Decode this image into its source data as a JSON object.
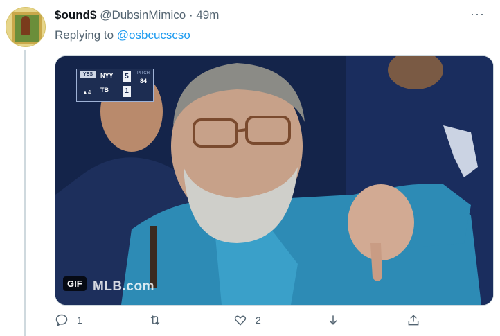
{
  "tweet": {
    "display_name": "$ound$",
    "handle": "@DubsinMimico",
    "separator": "·",
    "time": "49m",
    "replying_prefix": "Replying to ",
    "replying_to": "@osbcucscso",
    "more_label": "···"
  },
  "media": {
    "badge": "GIF",
    "watermark": "MLB.com",
    "scoreboard": {
      "network": "YES",
      "team1": "NYY",
      "score1": "5",
      "team2": "TB",
      "score2": "1",
      "pitch_label": "PITCH",
      "pitch_value": "84",
      "inning": "▲4"
    }
  },
  "actions": {
    "reply_count": "1",
    "retweet_count": "",
    "like_count": "2"
  },
  "colors": {
    "accent": "#1d9bf0",
    "muted": "#536471",
    "text": "#0f1419",
    "border": "#cfd9de"
  },
  "icons": [
    "reply-icon",
    "retweet-icon",
    "like-icon",
    "downvote-icon",
    "share-icon",
    "more-icon"
  ]
}
